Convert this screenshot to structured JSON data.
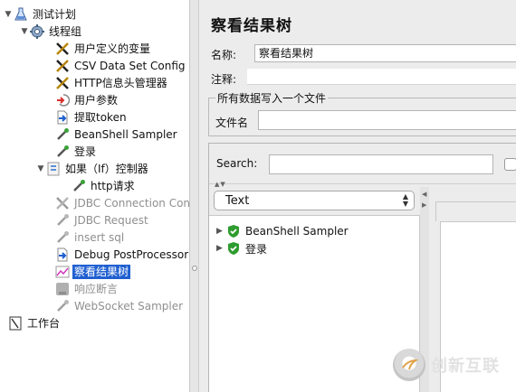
{
  "tree": {
    "items": [
      {
        "label": "测试计划",
        "icon": "flask-icon",
        "level": 0,
        "expanded": true,
        "enabled": true,
        "selected": false
      },
      {
        "label": "线程组",
        "icon": "gear-icon",
        "level": 1,
        "expanded": true,
        "enabled": true,
        "selected": false
      },
      {
        "label": "用户定义的变量",
        "icon": "wrench-icon",
        "level": 2,
        "enabled": true,
        "selected": false
      },
      {
        "label": "CSV Data Set Config",
        "icon": "wrench-icon",
        "level": 2,
        "enabled": true,
        "selected": false
      },
      {
        "label": "HTTP信息头管理器",
        "icon": "wrench-icon",
        "level": 2,
        "enabled": true,
        "selected": false
      },
      {
        "label": "用户参数",
        "icon": "pre-processor-icon",
        "level": 2,
        "enabled": true,
        "selected": false
      },
      {
        "label": "提取token",
        "icon": "post-processor-icon",
        "level": 2,
        "enabled": true,
        "selected": false
      },
      {
        "label": "BeanShell Sampler",
        "icon": "pipette-icon",
        "level": 2,
        "enabled": true,
        "selected": false
      },
      {
        "label": "登录",
        "icon": "pipette-icon",
        "level": 2,
        "enabled": true,
        "selected": false
      },
      {
        "label": "如果（If）控制器",
        "icon": "controller-icon",
        "level": 2,
        "expanded": true,
        "enabled": true,
        "selected": false
      },
      {
        "label": "http请求",
        "icon": "pipette-icon",
        "level": 3,
        "enabled": true,
        "selected": false
      },
      {
        "label": "JDBC Connection Conf",
        "icon": "wrench-icon",
        "level": 2,
        "enabled": false,
        "selected": false
      },
      {
        "label": "JDBC Request",
        "icon": "pipette-icon",
        "level": 2,
        "enabled": false,
        "selected": false
      },
      {
        "label": "insert sql",
        "icon": "pipette-icon",
        "level": 2,
        "enabled": false,
        "selected": false
      },
      {
        "label": "Debug PostProcessor",
        "icon": "post-processor-icon",
        "level": 2,
        "enabled": true,
        "selected": false
      },
      {
        "label": "察看结果树",
        "icon": "chart-icon",
        "level": 2,
        "enabled": true,
        "selected": true
      },
      {
        "label": "响应断言",
        "icon": "assertion-icon",
        "level": 2,
        "enabled": false,
        "selected": false
      },
      {
        "label": "WebSocket Sampler",
        "icon": "pipette-icon",
        "level": 2,
        "enabled": false,
        "selected": false
      },
      {
        "label": "工作台",
        "icon": "workbench-icon",
        "level": 0,
        "enabled": true,
        "selected": false
      }
    ]
  },
  "main": {
    "title": "察看结果树",
    "name_label": "名称:",
    "name_value": "察看结果树",
    "comment_label": "注释:",
    "comment_value": "",
    "file_group_legend": "所有数据写入一个文件",
    "filename_label": "文件名",
    "filename_value": "",
    "search_label": "Search:",
    "search_value": "",
    "renderer_value": "Text",
    "results": [
      {
        "label": "BeanShell Sampler",
        "status": "success"
      },
      {
        "label": "登录",
        "status": "success"
      }
    ]
  },
  "watermark": {
    "text": "创新互联"
  },
  "colors": {
    "selection": "#1f5fd1",
    "success_shield": "#2e9c2e",
    "disabled_text": "#8f8f8f"
  }
}
